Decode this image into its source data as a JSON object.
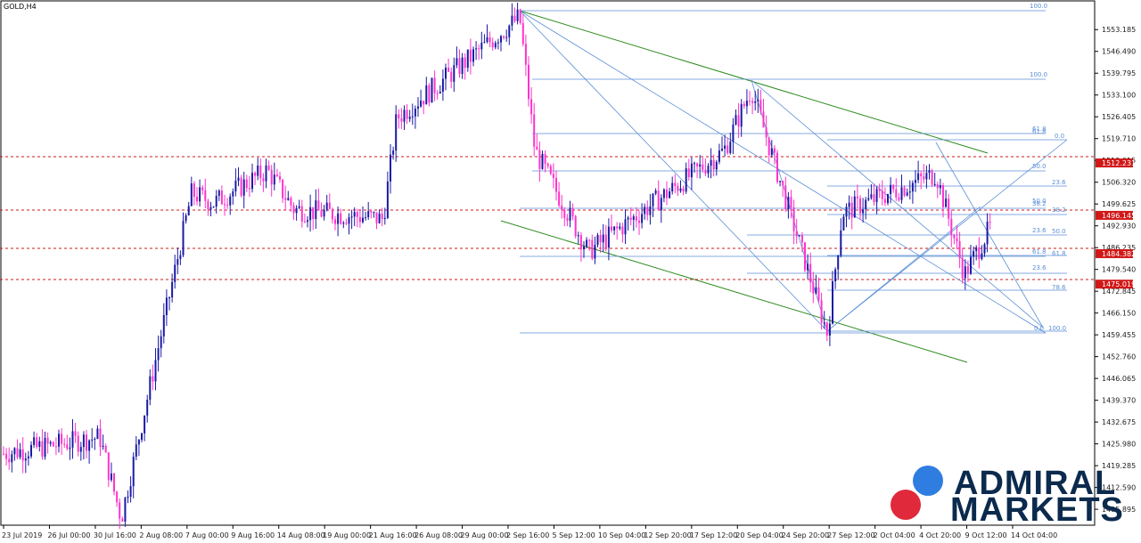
{
  "symbol": "GOLD,H4",
  "brand": {
    "line1": "ADMIRAL",
    "line2": "MARKETS"
  },
  "colors": {
    "bull": "#1a1aa6",
    "bear": "#ff33cc",
    "trend": "#2e8b1f",
    "fib": "#5b8fd6",
    "level": "#d11818",
    "logo_blue": "#2f7de1",
    "logo_red": "#e0293b",
    "logo_text": "#0b2a4d"
  },
  "price_axis": {
    "labels": [
      "1553.185",
      "1546.490",
      "1539.795",
      "1533.100",
      "1526.405",
      "1519.710",
      "1513.015",
      "1506.320",
      "1499.625",
      "1492.930",
      "1486.235",
      "1479.540",
      "1472.845",
      "1466.150",
      "1459.455",
      "1452.760",
      "1446.065",
      "1439.370",
      "1432.675",
      "1425.980",
      "1419.285",
      "1412.590",
      "1405.895"
    ]
  },
  "price_tags": [
    {
      "label": "1512.231",
      "value": 1512.231
    },
    {
      "label": "1496.145",
      "value": 1496.145
    },
    {
      "label": "1484.382",
      "value": 1484.382
    },
    {
      "label": "1475.019",
      "value": 1475.019
    }
  ],
  "time_axis": {
    "labels": [
      "23 Jul 2019",
      "26 Jul 00:00",
      "30 Jul 16:00",
      "2 Aug 08:00",
      "7 Aug 00:00",
      "9 Aug 16:00",
      "14 Aug 08:00",
      "19 Aug 00:00",
      "21 Aug 16:00",
      "26 Aug 08:00",
      "29 Aug 00:00",
      "2 Sep 16:00",
      "5 Sep 12:00",
      "10 Sep 04:00",
      "12 Sep 20:00",
      "17 Sep 12:00",
      "20 Sep 04:00",
      "24 Sep 20:00",
      "27 Sep 12:00",
      "2 Oct 04:00",
      "4 Oct 20:00",
      "9 Oct 12:00",
      "14 Oct 04:00"
    ]
  },
  "fib_labels": {
    "big": [
      "100.0",
      "100.0",
      "61.8",
      "50.0",
      "38.2",
      "0.0",
      "100.0"
    ],
    "right": [
      "0.0",
      "23.6",
      "38.2",
      "50.0",
      "61.8",
      "78.6",
      "100.0",
      "23.6",
      "50.0",
      "61.8",
      "23.6",
      "61.8",
      "78.6",
      "0.0"
    ]
  },
  "chart_data": {
    "type": "candlestick",
    "symbol": "GOLD,H4",
    "ylim": [
      1401,
      1562
    ],
    "key_points": [
      {
        "label": "23 Jul 2019",
        "close": 1423
      },
      {
        "label": "30 Jul 16:00",
        "close": 1403
      },
      {
        "label": "7 Aug 00:00",
        "close": 1503
      },
      {
        "label": "14 Aug 08:00",
        "close": 1510
      },
      {
        "label": "21 Aug 16:00",
        "close": 1495
      },
      {
        "label": "26 Aug 08:00",
        "close": 1526
      },
      {
        "label": "2 Sep 16:00",
        "close": 1557
      },
      {
        "label": "5 Sep 12:00",
        "close": 1516
      },
      {
        "label": "10 Sep 04:00",
        "close": 1485
      },
      {
        "label": "20 Sep 04:00",
        "close": 1516
      },
      {
        "label": "24 Sep 20:00",
        "close": 1535
      },
      {
        "label": "27 Sep 12:00",
        "close": 1460
      },
      {
        "label": "2 Oct 04:00",
        "close": 1497
      },
      {
        "label": "9 Oct 12:00",
        "close": 1509
      },
      {
        "label": "14 Oct 04:00",
        "close": 1478
      },
      {
        "label": "14 Oct 04:00",
        "close": 1493
      }
    ]
  }
}
